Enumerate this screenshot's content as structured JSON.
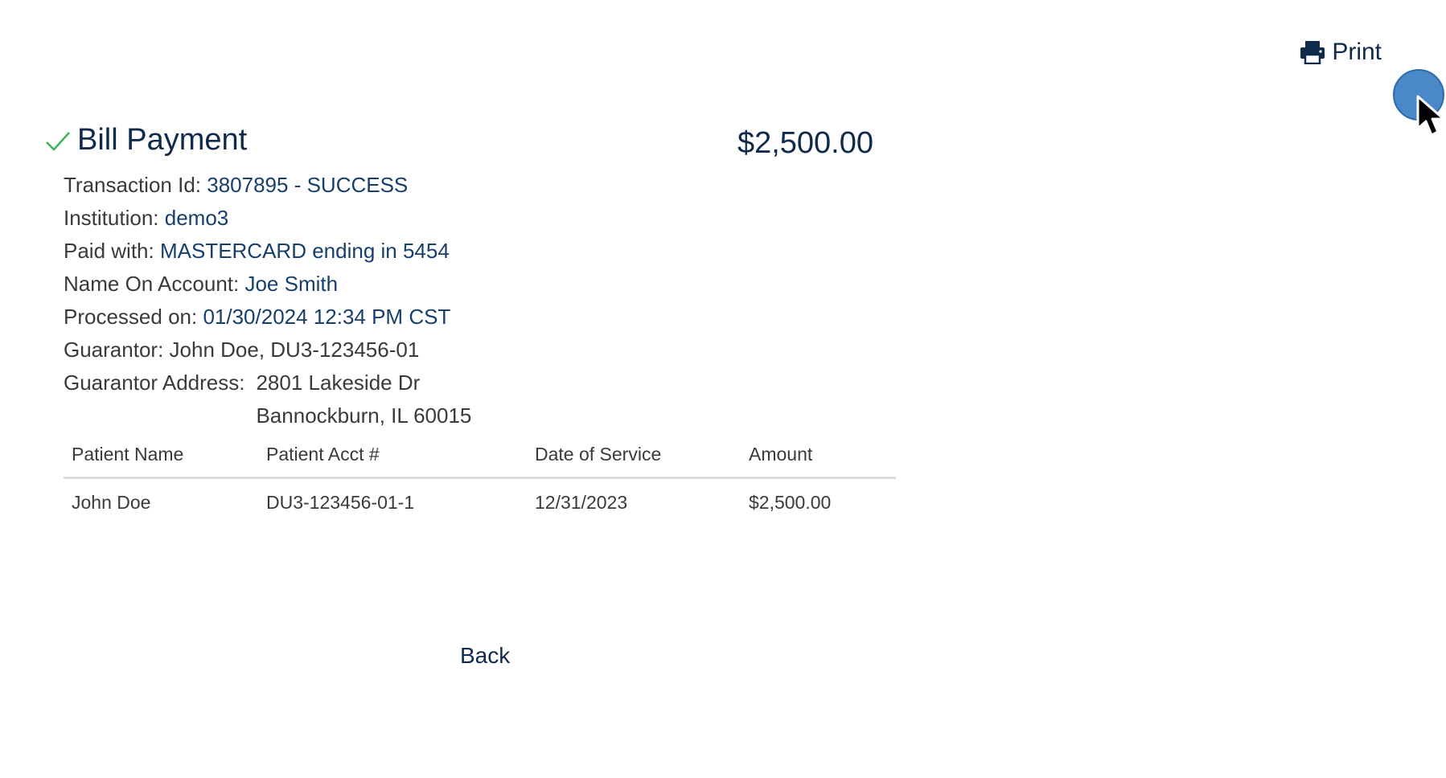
{
  "toolbar": {
    "print_label": "Print"
  },
  "receipt": {
    "title": "Bill Payment",
    "amount": "$2,500.00",
    "status_icon": "check-icon",
    "status_color": "#3cb55a"
  },
  "details": {
    "transaction_id_label": "Transaction Id:",
    "transaction_id_value": "3807895 - SUCCESS",
    "institution_label": "Institution:",
    "institution_value": "demo3",
    "paid_with_label": "Paid with:",
    "paid_with_value": "MASTERCARD ending in 5454",
    "name_on_account_label": "Name On Account:",
    "name_on_account_value": "Joe Smith",
    "processed_on_label": "Processed on:",
    "processed_on_value": "01/30/2024 12:34 PM CST",
    "guarantor_label": "Guarantor:",
    "guarantor_value": "John Doe, DU3-123456-01",
    "guarantor_address_label": "Guarantor Address:",
    "guarantor_address_line1": "2801 Lakeside Dr",
    "guarantor_address_line2": "Bannockburn, IL 60015"
  },
  "table": {
    "headers": [
      "Patient Name",
      "Patient Acct #",
      "Date of Service",
      "Amount"
    ],
    "rows": [
      [
        "John Doe",
        "DU3-123456-01-1",
        "12/31/2023",
        "$2,500.00"
      ]
    ]
  },
  "footer": {
    "back_label": "Back"
  },
  "colors": {
    "brand_navy": "#0f2a4a",
    "value_blue": "#173f6e",
    "cursor_highlight": "#4a88c9"
  }
}
